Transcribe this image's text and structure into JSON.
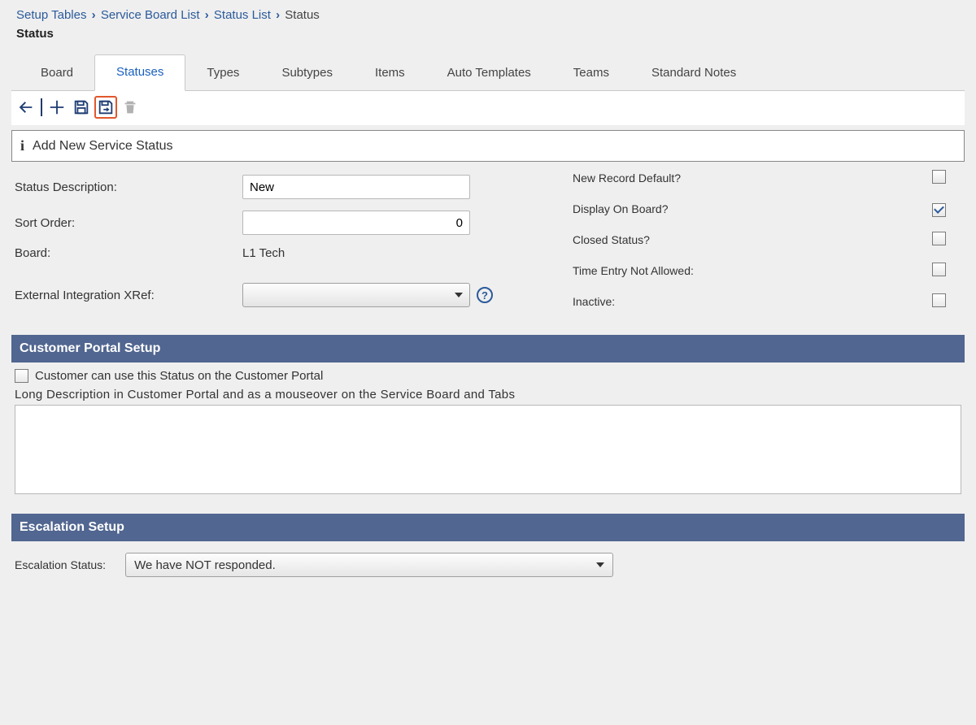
{
  "breadcrumb": {
    "items": [
      "Setup Tables",
      "Service Board List",
      "Status List"
    ],
    "current": "Status"
  },
  "page_title": "Status",
  "tabs": [
    {
      "label": "Board",
      "active": false
    },
    {
      "label": "Statuses",
      "active": true
    },
    {
      "label": "Types",
      "active": false
    },
    {
      "label": "Subtypes",
      "active": false
    },
    {
      "label": "Items",
      "active": false
    },
    {
      "label": "Auto Templates",
      "active": false
    },
    {
      "label": "Teams",
      "active": false
    },
    {
      "label": "Standard Notes",
      "active": false
    }
  ],
  "info_bar": "Add New Service Status",
  "form": {
    "status_description": {
      "label": "Status Description:",
      "value": "New"
    },
    "sort_order": {
      "label": "Sort Order:",
      "value": "0"
    },
    "board": {
      "label": "Board:",
      "value": "L1 Tech"
    },
    "xref": {
      "label": "External Integration XRef:",
      "value": ""
    }
  },
  "flags": {
    "new_record_default": {
      "label": "New Record Default?",
      "checked": false
    },
    "display_on_board": {
      "label": "Display On Board?",
      "checked": true
    },
    "closed_status": {
      "label": "Closed Status?",
      "checked": false
    },
    "time_entry_not_allowed": {
      "label": "Time Entry Not Allowed:",
      "checked": false
    },
    "inactive": {
      "label": "Inactive:",
      "checked": false
    }
  },
  "customer_portal": {
    "header": "Customer Portal Setup",
    "checkbox_label": "Customer can use this Status on the Customer Portal",
    "checkbox_checked": false,
    "long_desc_label": "Long Description in Customer Portal and as a mouseover on the Service Board and Tabs",
    "long_desc_value": ""
  },
  "escalation": {
    "header": "Escalation Setup",
    "label": "Escalation Status:",
    "value": "We have NOT responded."
  }
}
